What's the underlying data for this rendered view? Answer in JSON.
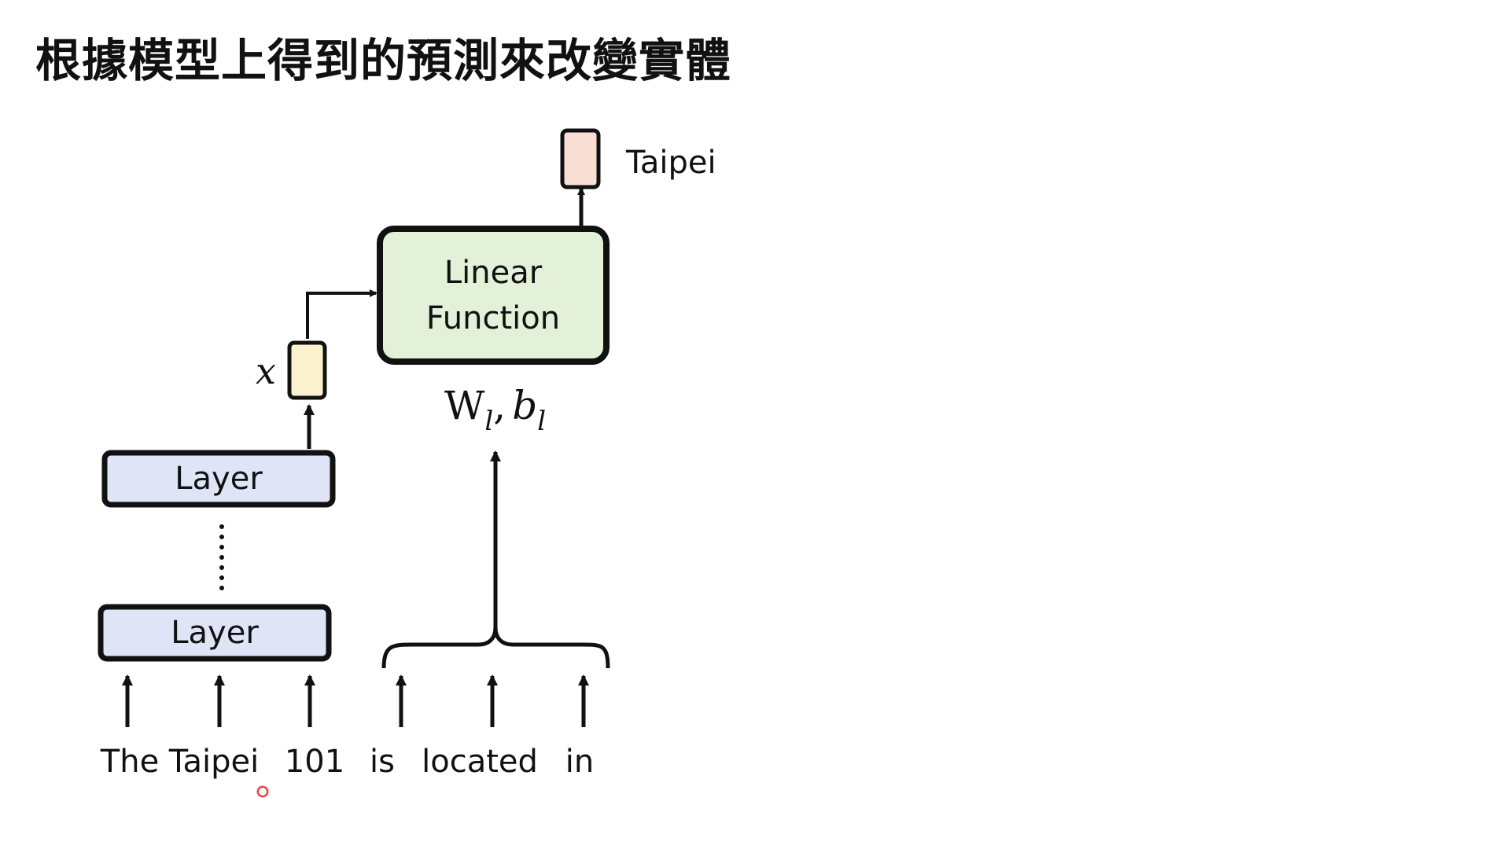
{
  "slide": {
    "title": "根據模型上得到的預測來改變實體"
  },
  "diagram": {
    "layer_labels": [
      "Layer",
      "Layer"
    ],
    "linear_function": {
      "line1": "Linear",
      "line2": "Function"
    },
    "hidden_vector_label": "x",
    "params": {
      "W": "W",
      "W_sub": "l",
      "sep": ",",
      "b": "b",
      "b_sub": "l"
    },
    "output_label": "Taipei",
    "input_tokens": [
      "The",
      "Taipei",
      "101",
      "is",
      "located",
      "in"
    ]
  },
  "colors": {
    "layer_fill": "#dfe5f7",
    "linear_fill": "#e2f1d8",
    "hidden_fill": "#fcf1cf",
    "output_fill": "#f8dfd5",
    "stroke": "#111111"
  }
}
